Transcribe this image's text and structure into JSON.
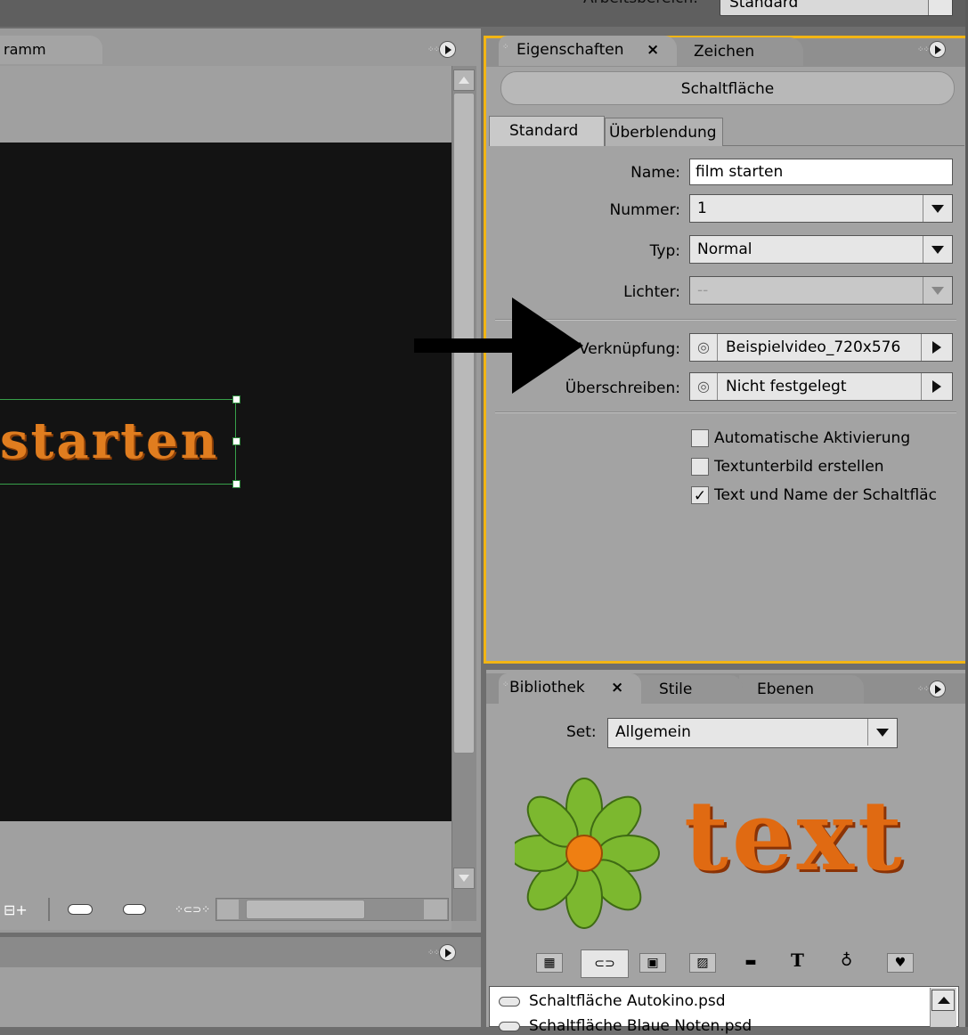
{
  "window": {
    "workspace_label": "Arbeitsbereich:",
    "workspace_value": "Standard"
  },
  "monitor": {
    "tab_label": "ramm",
    "canvas_text": "starten"
  },
  "properties": {
    "tabs": [
      "Eigenschaften",
      "Zeichen"
    ],
    "tab_close": "×",
    "header": "Schaltfläche",
    "subtabs": [
      "Standard",
      "Überblendung"
    ],
    "fields": {
      "name_label": "Name:",
      "name_value": "film starten",
      "nummer_label": "Nummer:",
      "nummer_value": "1",
      "typ_label": "Typ:",
      "typ_value": "Normal",
      "lichter_label": "Lichter:",
      "lichter_value": "--",
      "verknuepfung_label": "Verknüpfung:",
      "verknuepfung_value": "Beispielvideo_720x576",
      "ueberschreiben_label": "Überschreiben:",
      "ueberschreiben_value": "Nicht festgelegt"
    },
    "checkboxes": [
      {
        "label": "Automatische Aktivierung",
        "checked": false
      },
      {
        "label": "Textunterbild erstellen",
        "checked": false
      },
      {
        "label": "Text und Name der Schaltfläc",
        "checked": true
      }
    ],
    "accent_color": "#f2b514"
  },
  "library": {
    "tabs": [
      "Bibliothek",
      "Stile",
      "Ebenen"
    ],
    "tab_close": "×",
    "set_label": "Set:",
    "set_value": "Allgemein",
    "preview_text": "text",
    "icons": [
      "grid-icon",
      "button-icon",
      "image-icon",
      "pattern-icon",
      "folder-icon",
      "text-icon",
      "color-icon",
      "heart-icon"
    ],
    "icon_glyphs": [
      "▦",
      "⊂⊃",
      "▣",
      "▨",
      "▬",
      "T",
      "♁",
      "♥"
    ],
    "items": [
      "Schaltfläche Autokino.psd",
      "Schaltfläche Blaue Noten.psd"
    ]
  }
}
